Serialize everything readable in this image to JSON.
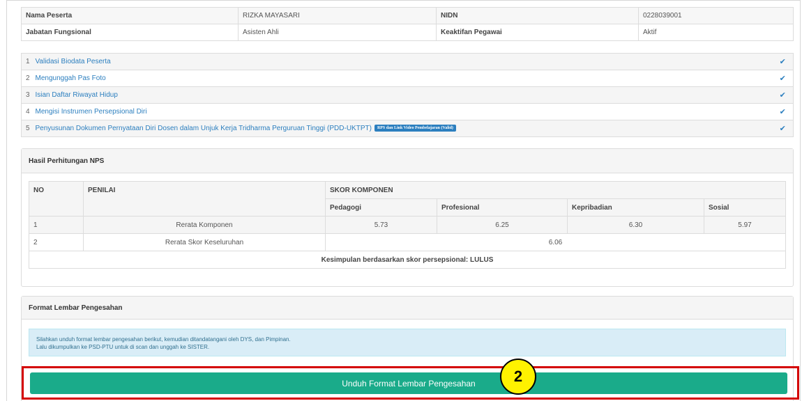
{
  "info": {
    "nama_label": "Nama Peserta",
    "nama_value": "RIZKA MAYASARI",
    "nidn_label": "NIDN",
    "nidn_value": "0228039001",
    "jabatan_label": "Jabatan Fungsional",
    "jabatan_value": "Asisten Ahli",
    "keaktifan_label": "Keaktifan Pegawai",
    "keaktifan_value": "Aktif"
  },
  "steps": [
    {
      "num": "1",
      "label": "Validasi Biodata Peserta",
      "status_icon": "check-icon"
    },
    {
      "num": "2",
      "label": "Mengunggah Pas Foto",
      "status_icon": "check-icon"
    },
    {
      "num": "3",
      "label": "Isian Daftar Riwayat Hidup",
      "status_icon": "check-icon"
    },
    {
      "num": "4",
      "label": "Mengisi Instrumen Persepsional Diri",
      "status_icon": "check-icon"
    },
    {
      "num": "5",
      "label": "Penyusunan Dokumen Pernyataan Diri Dosen dalam Unjuk Kerja Tridharma Perguruan Tinggi (PDD-UKTPT)",
      "badge": "RPS dan Link Video Pembelajaran (Valid)",
      "status_icon": "check-icon"
    }
  ],
  "nps": {
    "title": "Hasil Perhitungan NPS",
    "col_no": "NO",
    "col_penilai": "PENILAI",
    "col_skor": "SKOR KOMPONEN",
    "sub_pedagogi": "Pedagogi",
    "sub_profesional": "Profesional",
    "sub_kepribadian": "Kepribadian",
    "sub_sosial": "Sosial",
    "row1": {
      "no": "1",
      "penilai": "Rerata Komponen",
      "pedagogi": "5.73",
      "profesional": "6.25",
      "kepribadian": "6.30",
      "sosial": "5.97"
    },
    "row2": {
      "no": "2",
      "penilai": "Rerata Skor Keseluruhan",
      "total": "6.06"
    },
    "kesimpulan": "Kesimpulan berdasarkan skor persepsional: LULUS"
  },
  "format": {
    "title": "Format Lembar Pengesahan",
    "alert_line1": "Silahkan unduh format lembar pengesahan berikut, kemudian ditandatangani oleh DYS, dan Pimpinan.",
    "alert_line2": "Lalu dikumpulkan ke PSD-PTU untuk di scan dan unggah ke SISTER.",
    "button_label": "Unduh Format Lembar Pengesahan"
  },
  "annotation": {
    "marker_number": "2",
    "marker_color": "#fff200",
    "highlight_color": "#d40000"
  },
  "colors": {
    "link": "#2c7fbf",
    "button": "#1aab8a",
    "alert_bg": "#d9edf7"
  }
}
